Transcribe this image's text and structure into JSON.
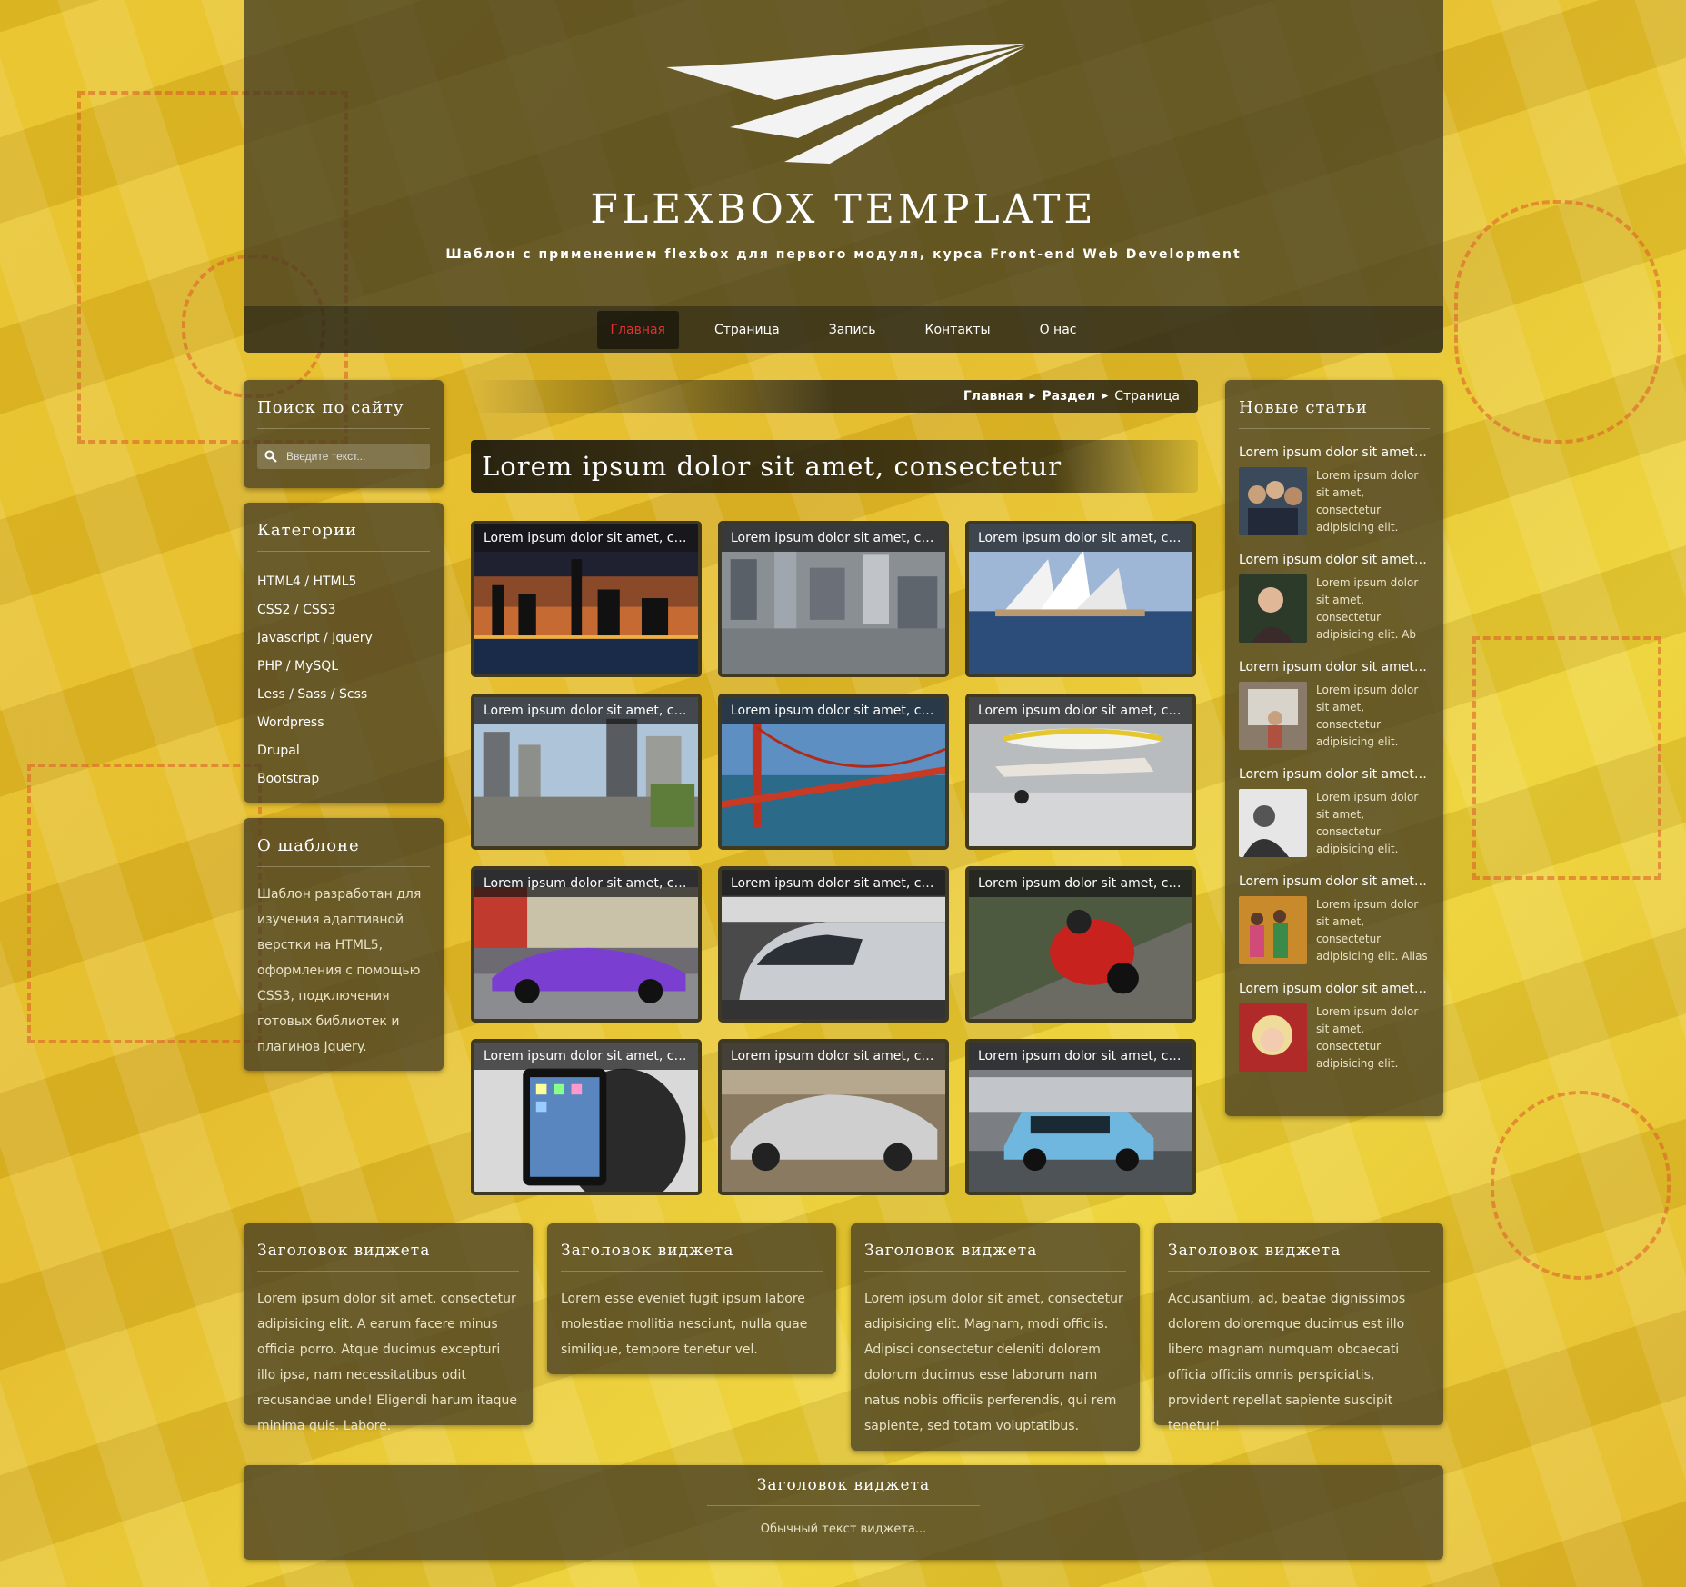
{
  "site": {
    "title": "FLEXBOX TEMPLATE",
    "subtitle": "Шаблон с применением flexbox для первого модуля, курса Front-end Web Development",
    "accent": "#d33333"
  },
  "nav": {
    "items": [
      {
        "label": "Главная",
        "active": true
      },
      {
        "label": "Страница",
        "active": false
      },
      {
        "label": "Запись",
        "active": false
      },
      {
        "label": "Контакты",
        "active": false
      },
      {
        "label": "О нас",
        "active": false
      }
    ]
  },
  "search": {
    "title": "Поиск по сайту",
    "placeholder": "Введите текст..."
  },
  "categories": {
    "title": "Категории",
    "items": [
      "HTML4 / HTML5",
      "CSS2 / CSS3",
      "Javascript / Jquery",
      "PHP / MySQL",
      "Less / Sass / Scss",
      "Wordpress",
      "Drupal",
      "Bootstrap"
    ]
  },
  "about": {
    "title": "О шаблоне",
    "text": "Шаблон разработан для изучения адаптивной верстки на HTML5, оформления с помощью CSS3, подключения готовых библиотек и плагинов Jquery."
  },
  "breadcrumb": {
    "home": "Главная",
    "section": "Раздел",
    "current": "Страница"
  },
  "article": {
    "title": "Lorem ipsum dolor sit amet, consectetur"
  },
  "gallery": {
    "caption": "Lorem ipsum dolor sit amet, consectetur",
    "tiles": [
      {
        "icon": "night-city-skyline-photo"
      },
      {
        "icon": "city-aerial-photo"
      },
      {
        "icon": "sydney-opera-house-photo"
      },
      {
        "icon": "city-highway-photo"
      },
      {
        "icon": "golden-gate-bridge-photo"
      },
      {
        "icon": "small-airplane-photo"
      },
      {
        "icon": "purple-sports-car-photo"
      },
      {
        "icon": "high-speed-train-photo"
      },
      {
        "icon": "motorcycle-racer-photo"
      },
      {
        "icon": "man-holding-tablet-photo"
      },
      {
        "icon": "silver-sports-car-photo"
      },
      {
        "icon": "blue-mini-car-photo"
      }
    ]
  },
  "news": {
    "title": "Новые статьи",
    "items": [
      {
        "title": "Lorem ipsum dolor sit amet, consectetur",
        "text": "Lorem ipsum dolor sit amet, consectetur adipisicing elit. Error, omnis quam! Aliqui...",
        "icon": "group-photo-thumb"
      },
      {
        "title": "Lorem ipsum dolor sit amet, consectetur",
        "text": "Lorem ipsum dolor sit amet, consectetur adipisicing elit. Ab adipisci autem...",
        "icon": "woman-portrait-thumb"
      },
      {
        "title": "Lorem ipsum dolor sit amet, consectetur",
        "text": "Lorem ipsum dolor sit amet, consectetur adipisicing elit. Adipisci distinctio...",
        "icon": "woman-window-thumb"
      },
      {
        "title": "Lorem ipsum dolor sit amet, consectetur",
        "text": "Lorem ipsum dolor sit amet, consectetur adipisicing elit. Atque, autem...",
        "icon": "bw-portrait-thumb"
      },
      {
        "title": "Lorem ipsum dolor sit amet, consectetur",
        "text": "Lorem ipsum dolor sit amet, consectetur adipisicing elit. Alias consequatur, dolore...",
        "icon": "dancers-thumb"
      },
      {
        "title": "Lorem ipsum dolor sit amet, consectetur",
        "text": "Lorem ipsum dolor sit amet, consectetur adipisicing elit. Aspernatur blanditii...",
        "icon": "blonde-girl-thumb"
      }
    ]
  },
  "widgets": [
    {
      "title": "Заголовок виджета",
      "text": "Lorem ipsum dolor sit amet, consectetur adipisicing elit. A earum facere minus officia porro. Atque ducimus excepturi illo ipsa, nam necessitatibus odit recusandae unde! Eligendi harum itaque minima quis. Labore."
    },
    {
      "title": "Заголовок виджета",
      "text": "Lorem esse eveniet fugit ipsum labore molestiae mollitia nesciunt, nulla quae similique, tempore tenetur vel."
    },
    {
      "title": "Заголовок виджета",
      "text": "Lorem ipsum dolor sit amet, consectetur adipisicing elit. Magnam, modi officiis. Adipisci consectetur deleniti dolorem dolorum ducimus esse laborum nam natus nobis officiis perferendis, qui rem sapiente, sed totam voluptatibus."
    },
    {
      "title": "Заголовок виджета",
      "text": "Accusantium, ad, beatae dignissimos dolorem doloremque ducimus est illo libero magnam numquam obcaecati officia officiis omnis perspiciatis, provident repellat sapiente suscipit tenetur!"
    }
  ],
  "footer": {
    "title": "Заголовок виджета",
    "text": "Обычный текст виджета..."
  }
}
